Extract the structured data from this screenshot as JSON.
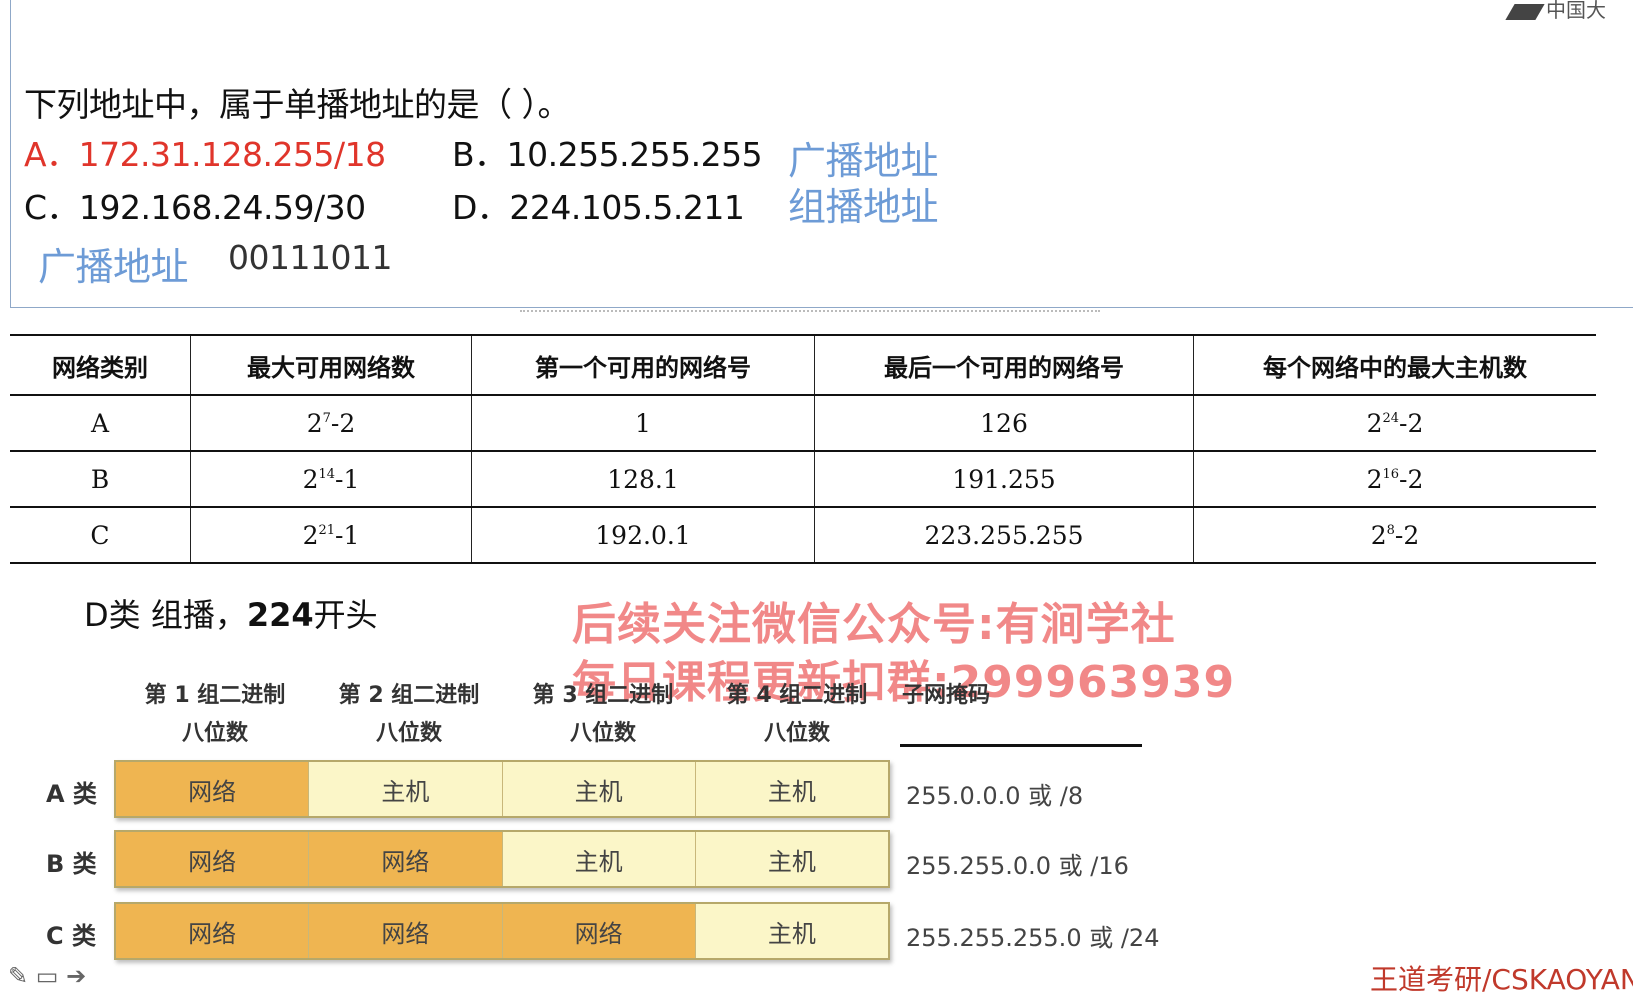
{
  "corner_logo": "中国大",
  "question": {
    "stem": "下列地址中，属于单播地址的是（        ）。",
    "option_a": "A．172.31.128.255/18",
    "option_b": "B．10.255.255.255",
    "option_c": "C．192.168.24.59/30",
    "option_d": "D．224.105.5.211",
    "note_b": "广播地址",
    "note_d": "组播地址",
    "note_c": "广播地址",
    "note_c_binary": "00111011"
  },
  "class_table": {
    "headers": [
      "网络类别",
      "最大可用网络数",
      "第一个可用的网络号",
      "最后一个可用的网络号",
      "每个网络中的最大主机数"
    ],
    "rows": [
      {
        "cls": "A",
        "max_base": "2",
        "max_exp": "7",
        "max_tail": "-2",
        "first": "1",
        "last": "126",
        "host_base": "2",
        "host_exp": "24",
        "host_tail": "-2"
      },
      {
        "cls": "B",
        "max_base": "2",
        "max_exp": "14",
        "max_tail": "-1",
        "first": "128.1",
        "last": "191.255",
        "host_base": "2",
        "host_exp": "16",
        "host_tail": "-2"
      },
      {
        "cls": "C",
        "max_base": "2",
        "max_exp": "21",
        "max_tail": "-1",
        "first": "192.0.1",
        "last": "223.255.255",
        "host_base": "2",
        "host_exp": "8",
        "host_tail": "-2"
      }
    ]
  },
  "d_note": {
    "prefix": "D类 组播，",
    "bold": "224",
    "suffix": "开头"
  },
  "watermark": {
    "line1": "后续关注微信公众号:有涧学社",
    "line2": "每日课程更新扣群:299963939"
  },
  "octet_diagram": {
    "col_headers": [
      {
        "l1": "第 1 组二进制",
        "l2": "八位数"
      },
      {
        "l1": "第 2 组二进制",
        "l2": "八位数"
      },
      {
        "l1": "第 3 组二进制",
        "l2": "八位数"
      },
      {
        "l1": "第 4 组二进制",
        "l2": "八位数"
      }
    ],
    "mask_header": "子网掩码",
    "rows": [
      {
        "label": "A 类",
        "cells": [
          "网络",
          "主机",
          "主机",
          "主机"
        ],
        "mask": "255.0.0.0 或 /8"
      },
      {
        "label": "B 类",
        "cells": [
          "网络",
          "网络",
          "主机",
          "主机"
        ],
        "mask": "255.255.0.0 或 /16"
      },
      {
        "label": "C 类",
        "cells": [
          "网络",
          "网络",
          "网络",
          "主机"
        ],
        "mask": "255.255.255.0 或 /24"
      }
    ],
    "network_word": "网络",
    "host_word": "主机"
  },
  "footer_brand": "王道考研/CSKAOYAN"
}
